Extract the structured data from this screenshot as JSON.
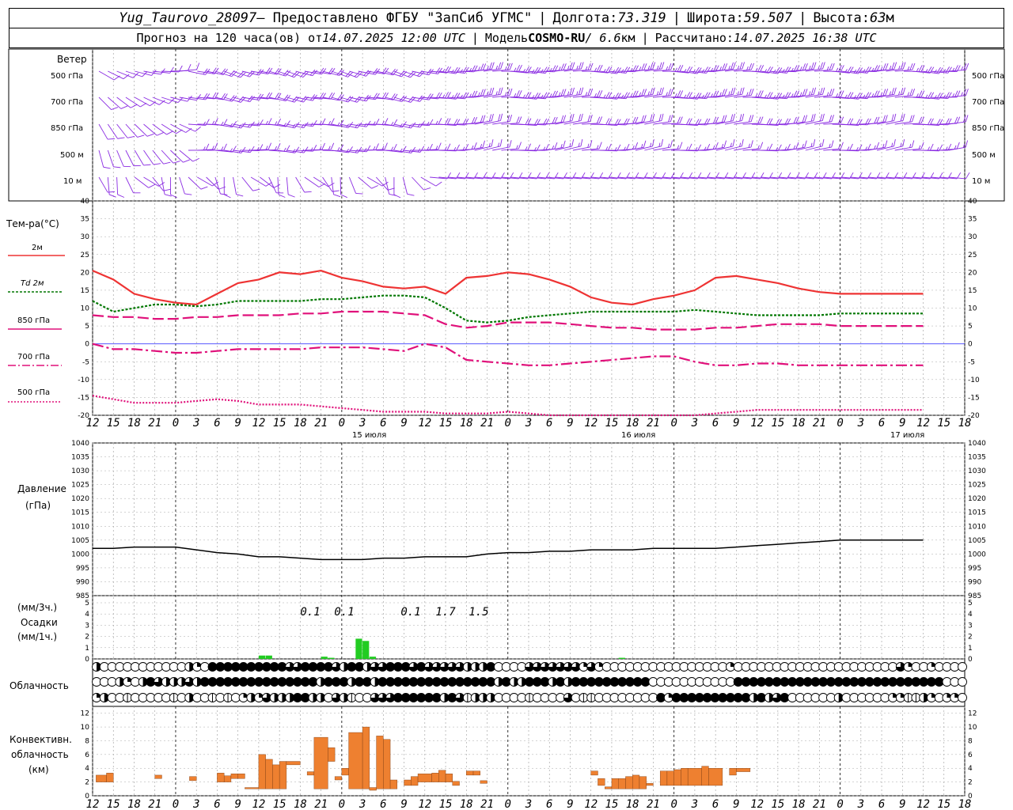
{
  "header": {
    "station": "Yug_Taurovo_28097",
    "provider": " – Предоставлено ФГБУ \"ЗапСиб УГМС\" ",
    "lon_label": "Долгота: ",
    "lon": "73.319",
    "lat_label": "Широта: ",
    "lat": "59.507",
    "alt_label": "Высота: ",
    "alt": "63",
    "alt_unit": "м",
    "forecast_label": "Прогноз на 120 часа(ов) от ",
    "forecast_time": "14.07.2025 12:00 UTC",
    "model_label": "Модель ",
    "model": "COSMO-RU",
    "model_res": " / 6.6",
    "model_res_unit": "км",
    "calc_label": "Рассчитано: ",
    "calc_time": "14.07.2025 16:38 UTC"
  },
  "labels": {
    "wind": "Ветер",
    "wind_levels": [
      "500 гПа",
      "700 гПа",
      "850 гПа",
      "500 м",
      "10 м"
    ],
    "temp_title": "Тем-ра(°С)",
    "temp_series": [
      "2м",
      "Td 2м",
      "850 гПа",
      "700 гПа",
      "500 гПа"
    ],
    "pressure_title": "Давление",
    "pressure_unit": "(гПа)",
    "precip_unit3": "(мм/3ч.)",
    "precip_title": "Осадки",
    "precip_unit1": "(мм/1ч.)",
    "cloud_title": "Облачность",
    "conv_title1": "Конвективн.",
    "conv_title2": "облачность",
    "conv_unit": "(км)",
    "dates": [
      "15 июля",
      "16 июля",
      "17 июля"
    ]
  },
  "colors": {
    "t2m": "#ee3333",
    "td2m": "#007700",
    "t850": "#e0107a",
    "t700": "#e0107a",
    "t500": "#e0107a",
    "wind": "#8a2be2",
    "precip": "#22cc22",
    "conv": "#ee8030",
    "pressure": "#000000",
    "zero_line": "#4040ff"
  },
  "chart_data": [
    {
      "type": "line",
      "title": "Тем-ра(°С)",
      "x_hours": [
        0,
        3,
        6,
        9,
        12,
        15,
        18,
        21,
        24,
        27,
        30,
        33,
        36,
        39,
        42,
        45,
        48,
        51,
        54,
        57,
        60,
        63,
        66,
        69,
        72,
        75,
        78,
        81,
        84,
        87,
        90,
        93,
        96,
        99,
        102,
        105,
        108,
        111,
        114,
        117,
        120
      ],
      "xtick_labels": [
        "12",
        "15",
        "18",
        "21",
        "0",
        "3",
        "6",
        "9",
        "12",
        "15",
        "18",
        "21",
        "0",
        "3",
        "6",
        "9",
        "12",
        "15",
        "18",
        "21",
        "0",
        "3",
        "6",
        "9",
        "12",
        "15",
        "18",
        "21",
        "0",
        "3",
        "6",
        "9",
        "12",
        "15",
        "18",
        "21",
        "0",
        "3",
        "6",
        "9",
        "12",
        "15",
        "18"
      ],
      "ylim": [
        -20,
        40
      ],
      "series": [
        {
          "name": "2м",
          "values": [
            20.5,
            18,
            14,
            12.5,
            11.5,
            11,
            14,
            17,
            18,
            20,
            19.5,
            20.5,
            18.5,
            17.5,
            16,
            15.5,
            16,
            14,
            18.5,
            19,
            20,
            19.5,
            18,
            16,
            13,
            11.5,
            11,
            12.5,
            13.5,
            15,
            18.5,
            19,
            18,
            17,
            15.5,
            14.5,
            14,
            14,
            14,
            14,
            14
          ]
        },
        {
          "name": "Td 2м",
          "values": [
            12,
            9,
            10,
            11,
            11,
            10.5,
            11,
            12,
            12,
            12,
            12,
            12.5,
            12.5,
            13,
            13.5,
            13.5,
            13,
            10,
            6.5,
            6,
            6.5,
            7.5,
            8,
            8.5,
            9,
            9,
            9,
            9,
            9,
            9.5,
            9,
            8.5,
            8,
            8,
            8,
            8,
            8.5,
            8.5,
            8.5,
            8.5,
            8.5
          ]
        },
        {
          "name": "850 гПа",
          "values": [
            8,
            7.5,
            7.5,
            7,
            7,
            7.5,
            7.5,
            8,
            8,
            8,
            8.5,
            8.5,
            9,
            9,
            9,
            8.5,
            8,
            5.5,
            4.5,
            5,
            6,
            6,
            6,
            5.5,
            5,
            4.5,
            4.5,
            4,
            4,
            4,
            4.5,
            4.5,
            5,
            5.5,
            5.5,
            5.5,
            5,
            5,
            5,
            5,
            5
          ]
        },
        {
          "name": "700 гПа",
          "values": [
            0,
            -1.5,
            -1.5,
            -2,
            -2.5,
            -2.5,
            -2,
            -1.5,
            -1.5,
            -1.5,
            -1.5,
            -1,
            -1,
            -1,
            -1.5,
            -2,
            0,
            -1,
            -4.5,
            -5,
            -5.5,
            -6,
            -6,
            -5.5,
            -5,
            -4.5,
            -4,
            -3.5,
            -3.5,
            -5,
            -6,
            -6,
            -5.5,
            -5.5,
            -6,
            -6,
            -6,
            -6,
            -6,
            -6,
            -6
          ]
        },
        {
          "name": "500 гПа",
          "values": [
            -14.5,
            -15.5,
            -16.5,
            -16.5,
            -16.5,
            -16,
            -15.5,
            -16,
            -17,
            -17,
            -17,
            -17.5,
            -18,
            -18.5,
            -19,
            -19,
            -19,
            -19.5,
            -19.5,
            -19.5,
            -19,
            -19.5,
            -20,
            -20,
            -20,
            -20,
            -20,
            -20,
            -20,
            -20,
            -19.5,
            -19,
            -18.5,
            -18.5,
            -18.5,
            -18.5,
            -18.5,
            -18.5,
            -18.5,
            -18.5,
            -18.5
          ]
        }
      ]
    },
    {
      "type": "line",
      "title": "Давление",
      "ylim": [
        985,
        1040
      ],
      "series": [
        {
          "name": "Давление",
          "values": [
            1002,
            1002,
            1002.5,
            1002.5,
            1002.5,
            1001.5,
            1000.5,
            1000,
            999,
            999,
            998.5,
            998,
            998,
            998,
            998.5,
            998.5,
            999,
            999,
            999,
            1000,
            1000.5,
            1000.5,
            1001,
            1001,
            1001.5,
            1001.5,
            1001.5,
            1002,
            1002,
            1002,
            1002,
            1002.5,
            1003,
            1003.5,
            1004,
            1004.5,
            1005,
            1005,
            1005,
            1005,
            1005
          ]
        }
      ]
    },
    {
      "type": "bar",
      "title": "Осадки",
      "ylim": [
        0,
        5
      ],
      "annotations": [
        "0.1",
        "0.1",
        "0.1",
        "1.7",
        "1.5"
      ],
      "bars_hourly": [
        {
          "h": 24,
          "v": 0.3
        },
        {
          "h": 25,
          "v": 0.3
        },
        {
          "h": 33,
          "v": 0.2
        },
        {
          "h": 34,
          "v": 0.1
        },
        {
          "h": 38,
          "v": 1.8
        },
        {
          "h": 39,
          "v": 1.6
        },
        {
          "h": 40,
          "v": 0.2
        },
        {
          "h": 76,
          "v": 0.1
        }
      ]
    },
    {
      "type": "bar",
      "title": "Конвективн. облачность",
      "ylim": [
        0,
        13
      ],
      "bars": [
        {
          "h0": 0.5,
          "h1": 2,
          "b": 2,
          "t": 3
        },
        {
          "h0": 2,
          "h1": 3,
          "b": 2,
          "t": 3.3
        },
        {
          "h0": 9,
          "h1": 10,
          "b": 2.5,
          "t": 3
        },
        {
          "h0": 14,
          "h1": 15,
          "b": 2.2,
          "t": 2.8
        },
        {
          "h0": 18,
          "h1": 19,
          "b": 2,
          "t": 3.3
        },
        {
          "h0": 19,
          "h1": 20,
          "b": 2,
          "t": 2.9
        },
        {
          "h0": 20,
          "h1": 21,
          "b": 2.5,
          "t": 3.2
        },
        {
          "h0": 21,
          "h1": 22,
          "b": 2.5,
          "t": 3.2
        },
        {
          "h0": 22,
          "h1": 24,
          "b": 1,
          "t": 1.2
        },
        {
          "h0": 24,
          "h1": 25,
          "b": 1,
          "t": 6
        },
        {
          "h0": 25,
          "h1": 26,
          "b": 1,
          "t": 5.3
        },
        {
          "h0": 26,
          "h1": 27,
          "b": 1,
          "t": 4.5
        },
        {
          "h0": 27,
          "h1": 28,
          "b": 1,
          "t": 5
        },
        {
          "h0": 28,
          "h1": 30,
          "b": 4.5,
          "t": 5
        },
        {
          "h0": 31,
          "h1": 32,
          "b": 3,
          "t": 3.5
        },
        {
          "h0": 32,
          "h1": 34,
          "b": 1,
          "t": 8.5
        },
        {
          "h0": 34,
          "h1": 35,
          "b": 5,
          "t": 7
        },
        {
          "h0": 35,
          "h1": 36,
          "b": 2.3,
          "t": 2.8
        },
        {
          "h0": 36,
          "h1": 37,
          "b": 3,
          "t": 4
        },
        {
          "h0": 37,
          "h1": 39,
          "b": 1,
          "t": 9.2
        },
        {
          "h0": 39,
          "h1": 40,
          "b": 1,
          "t": 10
        },
        {
          "h0": 40,
          "h1": 41,
          "b": 0.8,
          "t": 1.2
        },
        {
          "h0": 41,
          "h1": 42,
          "b": 1,
          "t": 8.7
        },
        {
          "h0": 42,
          "h1": 43,
          "b": 1,
          "t": 8.2
        },
        {
          "h0": 43,
          "h1": 44,
          "b": 1,
          "t": 2.3
        },
        {
          "h0": 45,
          "h1": 46,
          "b": 1.5,
          "t": 2.3
        },
        {
          "h0": 46,
          "h1": 47,
          "b": 1.5,
          "t": 2.8
        },
        {
          "h0": 47,
          "h1": 49,
          "b": 2,
          "t": 3.2
        },
        {
          "h0": 49,
          "h1": 50,
          "b": 2,
          "t": 3.3
        },
        {
          "h0": 50,
          "h1": 51,
          "b": 2,
          "t": 3.7
        },
        {
          "h0": 51,
          "h1": 52,
          "b": 2,
          "t": 3.2
        },
        {
          "h0": 52,
          "h1": 53,
          "b": 1.5,
          "t": 2.1
        },
        {
          "h0": 54,
          "h1": 55,
          "b": 3,
          "t": 3.6
        },
        {
          "h0": 55,
          "h1": 56,
          "b": 3,
          "t": 3.6
        },
        {
          "h0": 56,
          "h1": 57,
          "b": 1.8,
          "t": 2.2
        },
        {
          "h0": 72,
          "h1": 73,
          "b": 3,
          "t": 3.6
        },
        {
          "h0": 73,
          "h1": 74,
          "b": 1.5,
          "t": 2.5
        },
        {
          "h0": 74,
          "h1": 75,
          "b": 1,
          "t": 1.3
        },
        {
          "h0": 75,
          "h1": 76,
          "b": 1,
          "t": 2.5
        },
        {
          "h0": 76,
          "h1": 77,
          "b": 1,
          "t": 2.5
        },
        {
          "h0": 77,
          "h1": 78,
          "b": 1,
          "t": 2.8
        },
        {
          "h0": 78,
          "h1": 79,
          "b": 1,
          "t": 3
        },
        {
          "h0": 79,
          "h1": 80,
          "b": 1,
          "t": 2.8
        },
        {
          "h0": 80,
          "h1": 81,
          "b": 1.5,
          "t": 1.8
        },
        {
          "h0": 82,
          "h1": 83,
          "b": 1.5,
          "t": 3.6
        },
        {
          "h0": 83,
          "h1": 84,
          "b": 1.5,
          "t": 3.6
        },
        {
          "h0": 84,
          "h1": 85,
          "b": 1.5,
          "t": 3.8
        },
        {
          "h0": 85,
          "h1": 86,
          "b": 1.5,
          "t": 4
        },
        {
          "h0": 86,
          "h1": 88,
          "b": 1.5,
          "t": 4
        },
        {
          "h0": 88,
          "h1": 89,
          "b": 1.5,
          "t": 4.3
        },
        {
          "h0": 89,
          "h1": 91,
          "b": 1.5,
          "t": 4
        },
        {
          "h0": 92,
          "h1": 93,
          "b": 3,
          "t": 4
        },
        {
          "h0": 93,
          "h1": 95,
          "b": 3.5,
          "t": 4
        }
      ]
    }
  ]
}
